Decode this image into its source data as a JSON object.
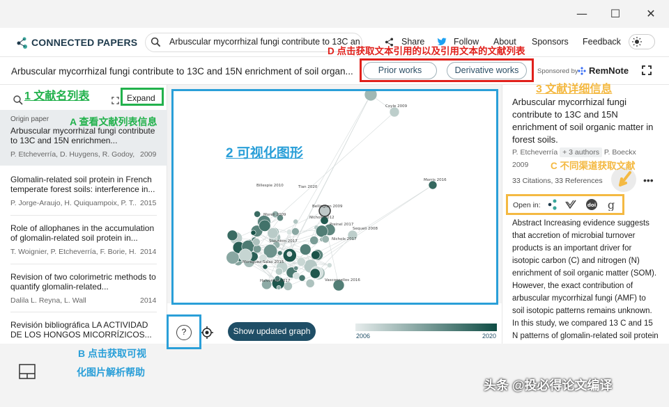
{
  "window": {
    "minimize": "—",
    "maximize": "☐",
    "close": "✕"
  },
  "header": {
    "brand": "CONNECTED PAPERS",
    "search_value": "Arbuscular mycorrhizal fungi contribute to 13C an",
    "nav": [
      "Share",
      "Follow",
      "About",
      "Sponsors",
      "Feedback"
    ]
  },
  "subheader": {
    "title": "Arbuscular mycorrhizal fungi contribute to 13C and 15N enrichment of soil organ...",
    "prior_works": "Prior works",
    "derivative_works": "Derivative works",
    "sponsored_by": "Sponsored by",
    "sponsor": "RemNote"
  },
  "left": {
    "expand": "Expand",
    "origin_label": "Origin paper",
    "items": [
      {
        "title": "Arbuscular mycorrhizal fungi contribute to 13C and 15N enrichmen...",
        "meta": "P. Etcheverría, D. Huygens, R. Godoy, F....",
        "year": "2009"
      },
      {
        "title": "Glomalin-related soil protein in French temperate forest soils: interference in...",
        "meta": "P. Jorge-Araujo, H. Quiquampoix, P. T....",
        "year": "2015"
      },
      {
        "title": "Role of allophanes in the accumulation of glomalin-related soil protein in...",
        "meta": "T. Woignier, P. Etcheverría, F. Borie, H....",
        "year": "2014"
      },
      {
        "title": "Revision of two colorimetric methods to quantify glomalin-related...",
        "meta": "Dalila L. Reyna, L. Wall",
        "year": "2014"
      },
      {
        "title": "Revisión bibliográfica LA ACTIVIDAD DE LOS HONGOS MICORRÍZICOS...",
        "meta": "",
        "year": ""
      }
    ]
  },
  "graph": {
    "labels": [
      "Coyle 2009",
      "Morris 2016",
      "Billespie 2010",
      "Tian 2020",
      "Bellington 2009",
      "Nichols 2012",
      "Staunton 2017",
      "Morell 2009",
      "Sequeli 2008",
      "Preinel 2017",
      "Nichols 2017",
      "Moraguez-Salas 2015",
      "Halvorson 2017",
      "Vasconcellos 2016"
    ],
    "show_updated": "Show updated graph",
    "help": "?",
    "year_start": "2006",
    "year_end": "2020"
  },
  "right": {
    "title": "Arbuscular mycorrhizal fungi contribute to 13C and 15N enrichment of soil organic matter in forest soils.",
    "author_first": "P. Etcheverría",
    "authors_more": "+ 3 authors",
    "author_last": "P. Boeckx",
    "year": "2009",
    "counts": "33 Citations, 33 References",
    "open_in": "Open in:",
    "abstract": "Abstract Increasing evidence suggests that accretion of microbial turnover products is an important driver for isotopic carbon (C) and nitrogen (N) enrichment of soil organic matter (SOM). However, the exact contribution of arbuscular mycorrhizal fungi (AMF) to soil isotopic patterns remains unknown. In this study, we compared 13 C and 15 N patterns of glomalin-related soil protein (GRSP) and bulk"
  },
  "annotations": {
    "a1": "1 文献名列表",
    "a2": "2 可视化图形",
    "a3": "3 文献详细信息",
    "aA": "A 查看文献列表信息",
    "aB1": "B 点击获取可视",
    "aB2": "化图片解析帮助",
    "aC": "C 不同渠道获取文献",
    "aD": "D 点击获取文本引用的以及引用文本的文献列表"
  },
  "watermark": "头条 @投必得论文编译",
  "colors": {
    "accent": "#1f4e66",
    "node": "#2f6b63",
    "green_box": "#22b14c",
    "blue_box": "#2a9fd8",
    "red_box": "#e0201b",
    "yellow_box": "#f4b942"
  }
}
